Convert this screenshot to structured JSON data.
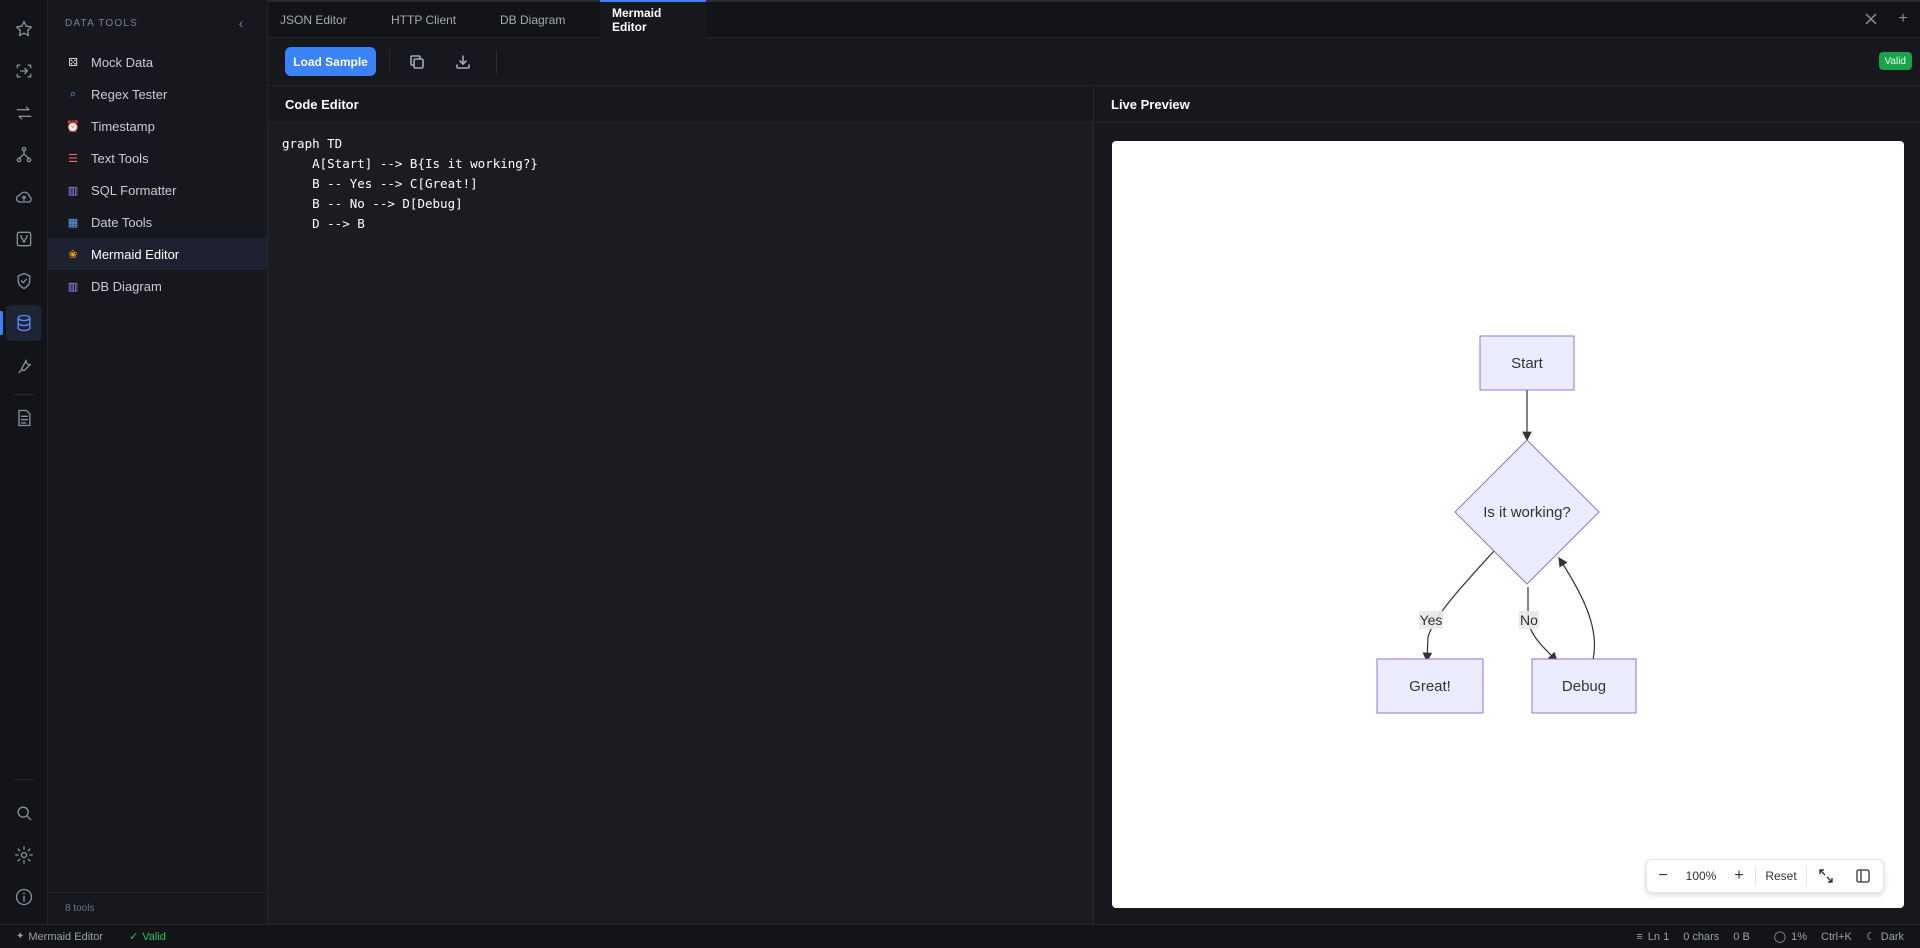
{
  "sidebar": {
    "title": "DATA TOOLS",
    "items": [
      {
        "label": "Mock Data",
        "icon": "dice-icon",
        "color": "#e5e7eb"
      },
      {
        "label": "Regex Tester",
        "icon": "magnifier-icon",
        "color": "#60a5fa"
      },
      {
        "label": "Timestamp",
        "icon": "alarm-clock-icon",
        "color": "#ef4444"
      },
      {
        "label": "Text Tools",
        "icon": "memo-icon",
        "color": "#f87171"
      },
      {
        "label": "SQL Formatter",
        "icon": "database-icon",
        "color": "#a78bfa"
      },
      {
        "label": "Date Tools",
        "icon": "calendar-icon",
        "color": "#60a5fa"
      },
      {
        "label": "Mermaid Editor",
        "icon": "mermaid-icon",
        "color": "#f59e0b"
      },
      {
        "label": "DB Diagram",
        "icon": "db-diagram-icon",
        "color": "#a78bfa"
      }
    ],
    "footer": "8 tools"
  },
  "tabs": [
    "JSON Editor",
    "HTTP Client",
    "DB Diagram",
    "Mermaid Editor"
  ],
  "toolbar": {
    "load_sample": "Load Sample",
    "status_badge": "Valid"
  },
  "editor": {
    "title": "Code Editor",
    "lines": [
      "graph TD",
      "    A[Start] --> B{Is it working?}",
      "    B -- Yes --> C[Great!]",
      "    B -- No --> D[Debug]",
      "    D --> B"
    ]
  },
  "preview": {
    "title": "Live Preview",
    "diagram": {
      "nodes": {
        "start": "Start",
        "decision": "Is it working?",
        "great": "Great!",
        "debug": "Debug"
      },
      "edge_labels": {
        "yes": "Yes",
        "no": "No"
      },
      "node_fill": "#ececff",
      "node_stroke": "#9370db"
    },
    "zoom": {
      "value": "100%",
      "minus": "−",
      "plus": "+",
      "reset": "Reset"
    }
  },
  "statusbar": {
    "tool": "Mermaid Editor",
    "valid": "Valid",
    "line": "Ln 1",
    "chars": "0 chars",
    "bytes": "0 B",
    "percent": "1%",
    "shortcut": "Ctrl+K",
    "theme": "Dark"
  },
  "colors": {
    "accent": "#3b82f6",
    "valid": "#22c55e"
  }
}
